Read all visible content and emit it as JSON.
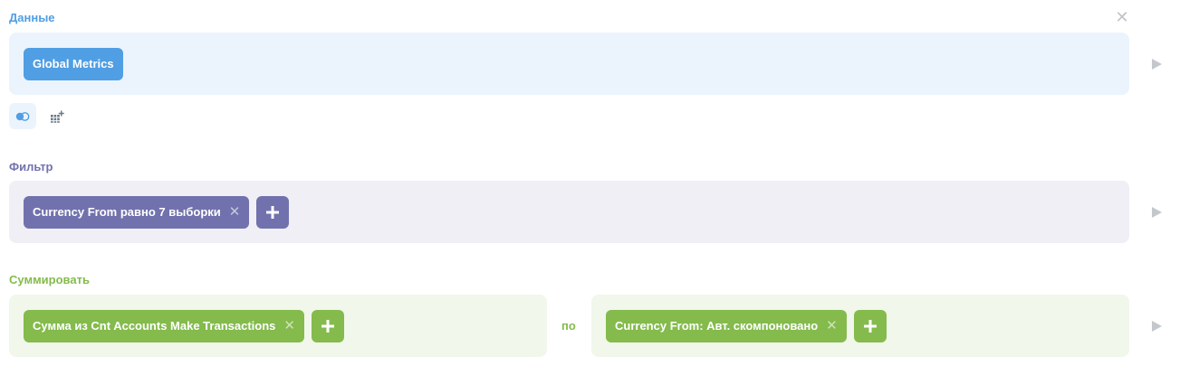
{
  "sections": {
    "data": {
      "title": "Данные",
      "table": "Global Metrics"
    },
    "filter": {
      "title": "Фильтр",
      "filters": [
        {
          "field": "Currency From",
          "operator": "равно",
          "value": "7 выборки"
        }
      ]
    },
    "summarize": {
      "title": "Суммировать",
      "metric": "Сумма из Cnt Accounts Make Transactions",
      "by_label": "по",
      "breakout": "Currency From: Авт. скомпоновано"
    }
  },
  "icons": {
    "close": "close-icon",
    "run": "play-icon",
    "join": "join-icon",
    "custom_column": "add-column-icon",
    "add": "plus-icon",
    "remove": "close-icon"
  },
  "colors": {
    "data": "#509ee3",
    "filter": "#7172ad",
    "summarize": "#84bb4c",
    "data_bg": "#ebf4fc",
    "filter_bg": "#efeff5",
    "summarize_bg": "#f1f7eb",
    "muted": "#c4c7cb"
  }
}
